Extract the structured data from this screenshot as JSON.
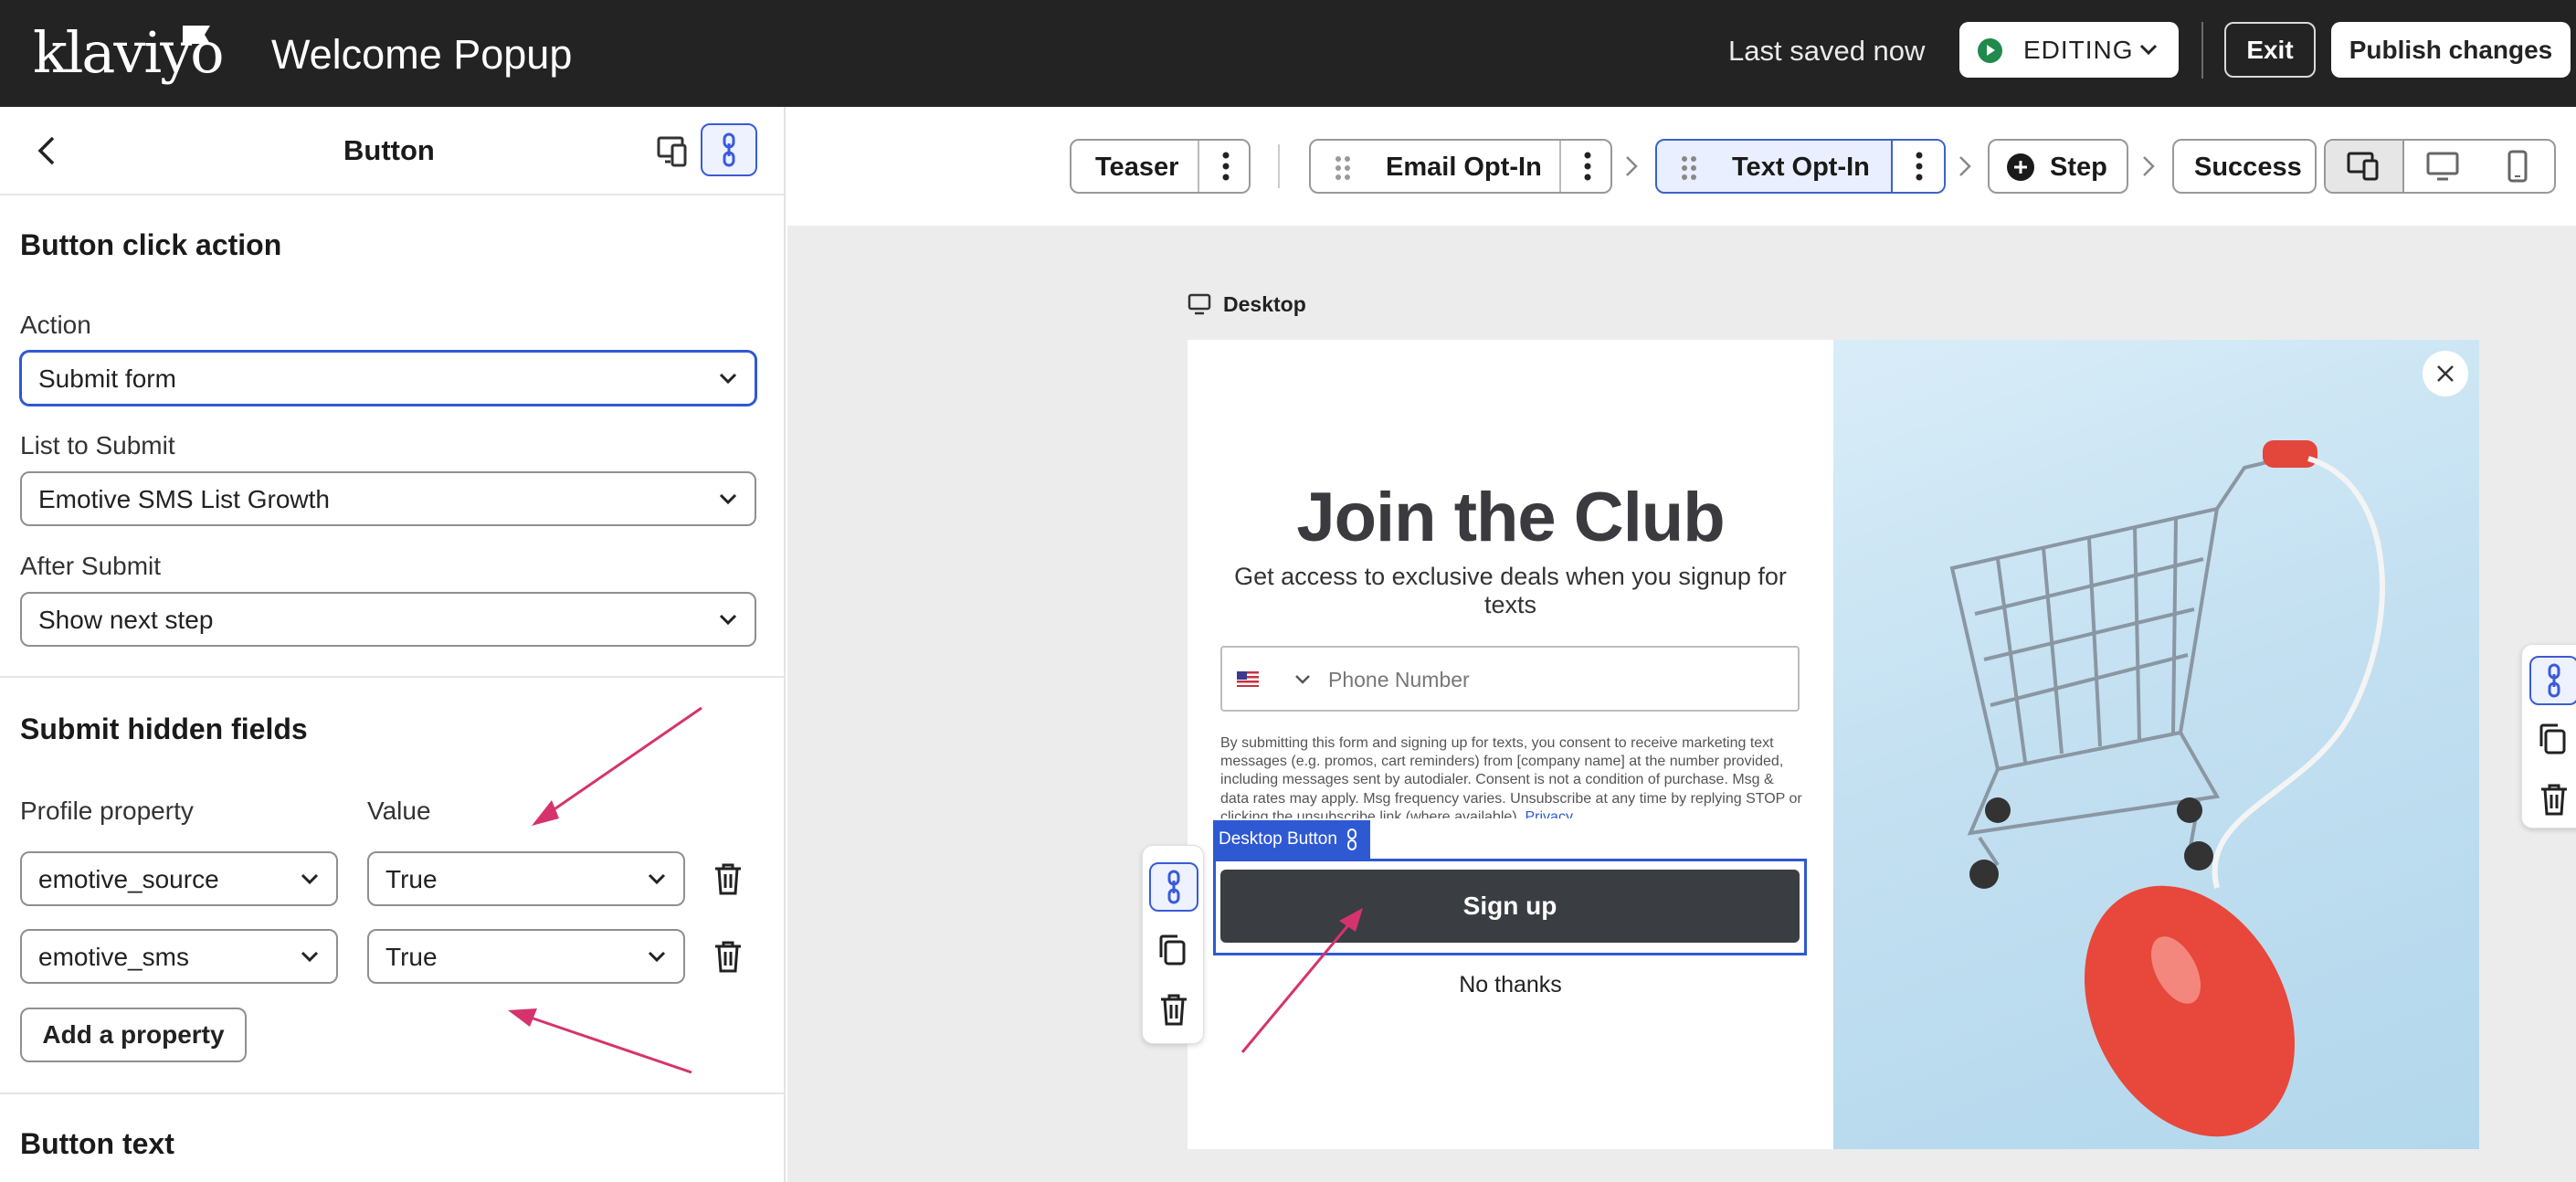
{
  "app": {
    "logo_text": "klaviyo",
    "title": "Welcome Popup",
    "saved_status": "Last saved now",
    "mode_label": "EDITING",
    "exit_label": "Exit",
    "publish_label": "Publish changes"
  },
  "panel": {
    "title": "Button",
    "click_action": {
      "heading": "Button click action",
      "action_label": "Action",
      "action_value": "Submit form",
      "list_label": "List to Submit",
      "list_value": "Emotive SMS List Growth",
      "after_label": "After Submit",
      "after_value": "Show next step"
    },
    "hidden_fields": {
      "heading": "Submit hidden fields",
      "col_property": "Profile property",
      "col_value": "Value",
      "rows": [
        {
          "property": "emotive_source",
          "value": "True"
        },
        {
          "property": "emotive_sms",
          "value": "True"
        }
      ],
      "add_label": "Add a property"
    },
    "button_text_heading": "Button text"
  },
  "steps": [
    {
      "label": "Teaser"
    },
    {
      "label": "Email Opt-In"
    },
    {
      "label": "Text Opt-In"
    },
    {
      "label": "Step"
    },
    {
      "label": "Success"
    }
  ],
  "canvas": {
    "device_label": "Desktop"
  },
  "popup": {
    "headline": "Join the Club",
    "subheadline": "Get access to exclusive deals when you signup for texts",
    "phone_placeholder": "Phone Number",
    "legal_text": "By submitting this form and signing up for texts, you consent to receive marketing text messages (e.g. promos, cart reminders) from [company name] at the number provided, including messages sent by autodialer. Consent is not a condition of purchase. Msg & data rates may apply. Msg frequency varies. Unsubscribe at any time by replying STOP or clicking the unsubscribe link (where available).",
    "legal_link": "Privacy",
    "selection_tag": "Desktop Button",
    "signup_label": "Sign up",
    "decline_label": "No thanks"
  },
  "colors": {
    "topbar": "#232323",
    "accent": "#2f59d3",
    "annotation_arrow": "#d6336c",
    "signup_button": "#3a3d42",
    "editing_dot": "#1f8a4c"
  }
}
